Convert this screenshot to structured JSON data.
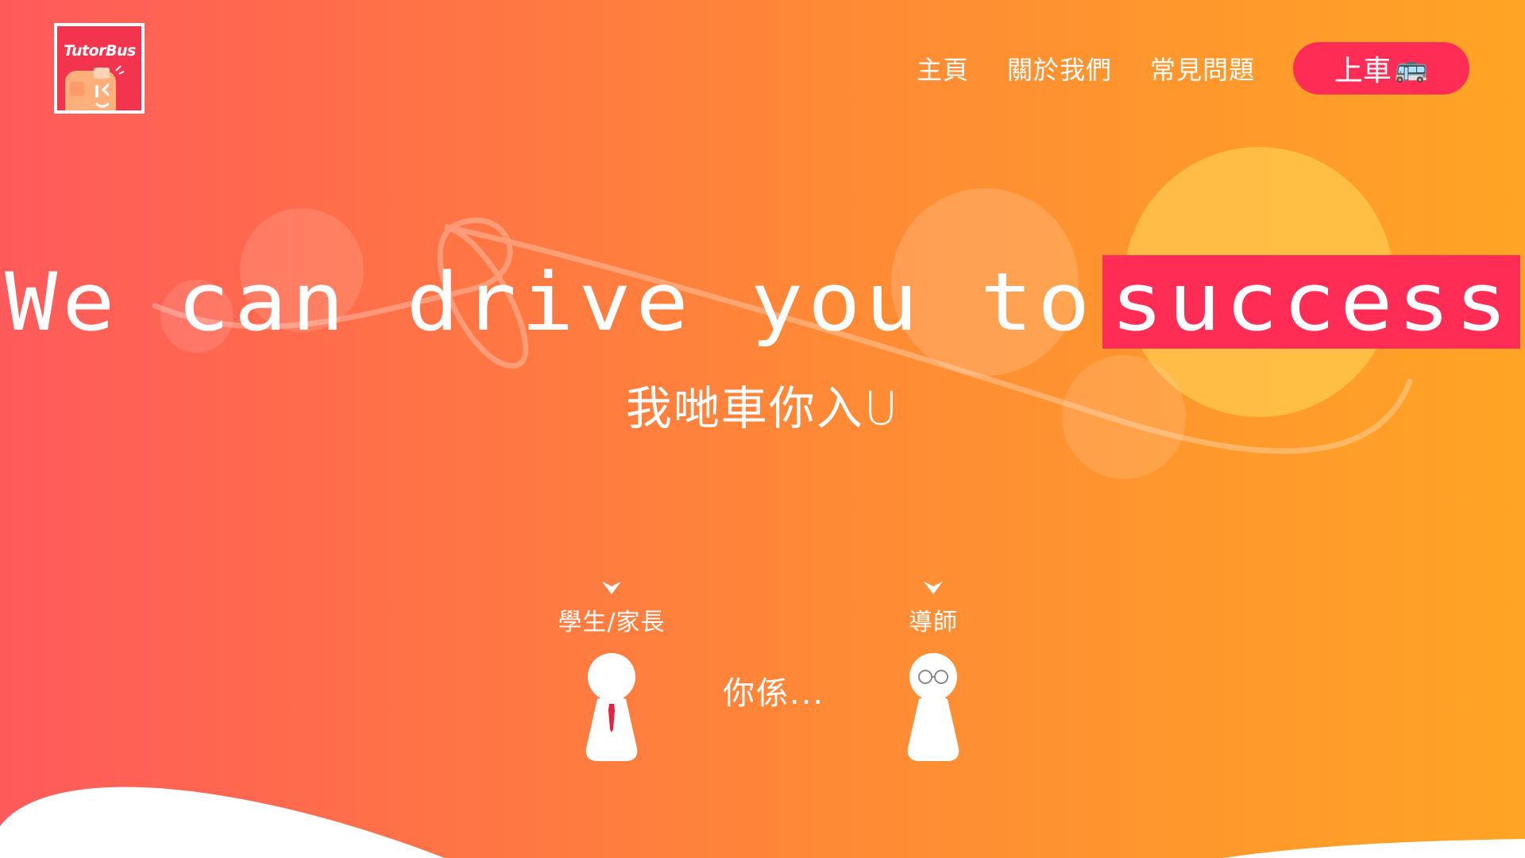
{
  "brand": {
    "logo_text": "TutorBus",
    "logo_bg": "#f2344f"
  },
  "nav": {
    "items": [
      {
        "label": "主頁"
      },
      {
        "label": "關於我們"
      },
      {
        "label": "常見問題"
      }
    ],
    "cta_label": "上車",
    "cta_icon": "bus-emoji",
    "cta_color": "#ff2d55"
  },
  "hero": {
    "title_prefix": "We can drive you to",
    "title_highlight": "success",
    "subtitle": "我哋車你入U"
  },
  "roles": {
    "prompt": "你係...",
    "student": {
      "label": "學生/家長",
      "icon": "student-pawn-with-tie"
    },
    "tutor": {
      "label": "導師",
      "icon": "tutor-pawn-with-glasses"
    }
  },
  "colors": {
    "gradient_start": "#ff5a5b",
    "gradient_end": "#ffa424",
    "accent": "#ff2d55"
  }
}
